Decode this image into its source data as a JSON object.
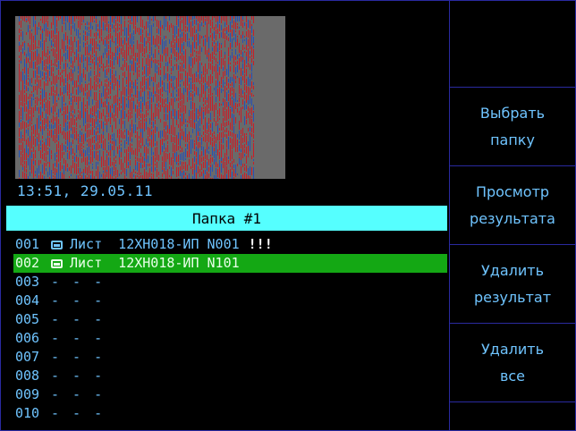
{
  "image": {
    "timestamp": "13:51, 29.05.11"
  },
  "folder": {
    "title": "Папка #1"
  },
  "rows": [
    {
      "num": "001",
      "kind": "file",
      "name": "Лист  12ХН018-ИП N001",
      "flag": "!!!"
    },
    {
      "num": "002",
      "kind": "file",
      "name": "Лист  12ХН018-ИП N101",
      "flag": "",
      "selected": true
    },
    {
      "num": "003",
      "kind": "empty",
      "name": "- - -"
    },
    {
      "num": "004",
      "kind": "empty",
      "name": "- - -"
    },
    {
      "num": "005",
      "kind": "empty",
      "name": "- - -"
    },
    {
      "num": "006",
      "kind": "empty",
      "name": "- - -"
    },
    {
      "num": "007",
      "kind": "empty",
      "name": "- - -"
    },
    {
      "num": "008",
      "kind": "empty",
      "name": "- - -"
    },
    {
      "num": "009",
      "kind": "empty",
      "name": "- - -"
    },
    {
      "num": "010",
      "kind": "empty",
      "name": "- - -"
    }
  ],
  "softkeys": [
    {
      "line1": "",
      "line2": ""
    },
    {
      "line1": "Выбрать",
      "line2": "папку"
    },
    {
      "line1": "Просмотр",
      "line2": "результата"
    },
    {
      "line1": "Удалить",
      "line2": "результат"
    },
    {
      "line1": "Удалить",
      "line2": "все"
    },
    {
      "line1": "",
      "line2": ""
    }
  ],
  "colors": {
    "background": "#000000",
    "text": "#6fc4ff",
    "header_bar": "#55ffff",
    "selected_row": "#14a814",
    "border": "#2a2aa0",
    "preview_bg": "#6a6a6a",
    "preview_trace_red": "#c81e28",
    "preview_trace_blue": "#2850b4"
  },
  "icons": {
    "file_icon": "folder-icon"
  }
}
